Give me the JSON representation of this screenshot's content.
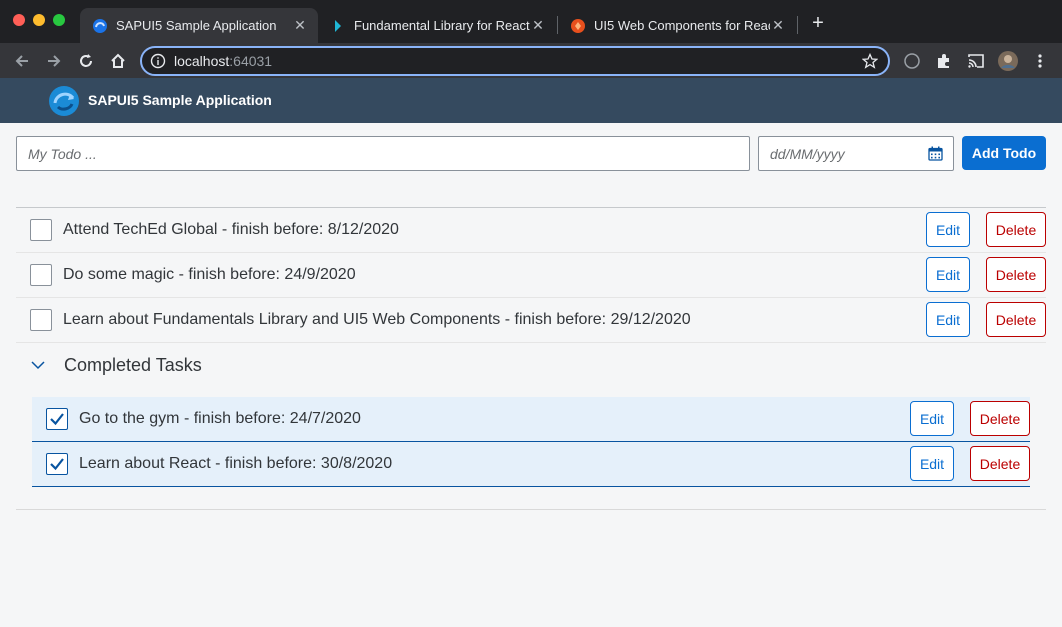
{
  "browser": {
    "tabs": [
      {
        "title": "SAPUI5 Sample Application",
        "active": true
      },
      {
        "title": "Fundamental Library for React",
        "active": false
      },
      {
        "title": "UI5 Web Components for React",
        "active": false
      }
    ],
    "url_host": "localhost",
    "url_port": ":64031"
  },
  "shell": {
    "title": "SAPUI5 Sample Application"
  },
  "form": {
    "todo_placeholder": "My Todo ...",
    "date_placeholder": "dd/MM/yyyy",
    "add_label": "Add Todo"
  },
  "todos": [
    {
      "text": "Attend TechEd Global - finish before: 8/12/2020",
      "done": false
    },
    {
      "text": "Do some magic - finish before: 24/9/2020",
      "done": false
    },
    {
      "text": "Learn about Fundamentals Library and UI5 Web Components - finish before: 29/12/2020",
      "done": false
    }
  ],
  "completed": {
    "title": "Completed Tasks",
    "items": [
      {
        "text": "Go to the gym - finish before: 24/7/2020",
        "done": true
      },
      {
        "text": "Learn about React - finish before: 30/8/2020",
        "done": true
      }
    ]
  },
  "labels": {
    "edit": "Edit",
    "delete": "Delete"
  },
  "colors": {
    "shell_bg": "#354a5f",
    "accent": "#0a6ed1",
    "delete": "#bb0000",
    "completed_bg": "#e5f0fa"
  },
  "icons": {
    "back": "arrow-left-icon",
    "forward": "arrow-right-icon",
    "reload": "reload-icon",
    "home": "home-icon",
    "calendar": "calendar-icon",
    "chevron": "chevron-down-icon"
  }
}
